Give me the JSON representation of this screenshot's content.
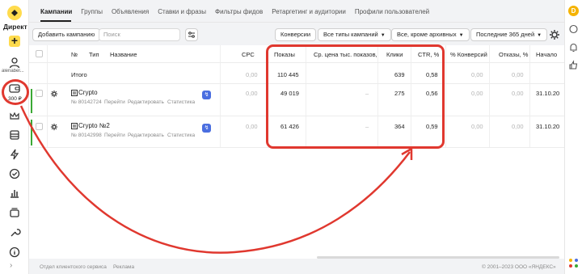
{
  "sidebar": {
    "brand": "Директ",
    "user": "alenabel...",
    "wallet": "300 ₽"
  },
  "tabs": [
    {
      "label": "Кампании",
      "active": true
    },
    {
      "label": "Группы"
    },
    {
      "label": "Объявления"
    },
    {
      "label": "Ставки и фразы"
    },
    {
      "label": "Фильтры фидов"
    },
    {
      "label": "Ретаргетинг и аудитории"
    },
    {
      "label": "Профили пользователей"
    }
  ],
  "toolbar": {
    "add_campaign": "Добавить кампанию",
    "search_placeholder": "Поиск",
    "conversions": "Конверсии",
    "campaign_types": "Все типы кампаний",
    "status_filter": "Все, кроме архивных",
    "period": "Последние 365 дней"
  },
  "table": {
    "headers": {
      "num": "№",
      "type": "Тип",
      "name": "Название",
      "cpc": "CPC",
      "impressions": "Показы",
      "cpm": "Ср. цена тыс. показов,",
      "clicks": "Клики",
      "ctr": "CTR, %",
      "conv": "% Конверсий",
      "bounces": "Отказы, %",
      "start": "Начало"
    },
    "total": {
      "label": "Итого",
      "cpc": "0,00",
      "impressions": "110 445",
      "clicks": "639",
      "ctr": "0,58",
      "conv": "0,00",
      "bounces": "0,00"
    },
    "rows": [
      {
        "name": "Crypto",
        "id": "№ 80142724",
        "actions": [
          "Перейти",
          "Редактировать",
          "Статистика"
        ],
        "cpc": "0,00",
        "impressions": "49 019",
        "cpm": "–",
        "clicks": "275",
        "ctr": "0,56",
        "conv": "0,00",
        "bounces": "0,00",
        "start": "31.10.20"
      },
      {
        "name": "Crypto №2",
        "id": "№ 80142998",
        "actions": [
          "Перейти",
          "Редактировать",
          "Статистика"
        ],
        "cpc": "0,00",
        "impressions": "61 426",
        "cpm": "–",
        "clicks": "364",
        "ctr": "0,59",
        "conv": "0,00",
        "bounces": "0,00",
        "start": "31.10.20"
      }
    ]
  },
  "footer": {
    "support": "Отдел клиентского сервиса",
    "ads": "Реклама",
    "copyright": "© 2001–2023 ООО «ЯНДЕКС»"
  },
  "colors": {
    "accent_yellow": "#ffdb4d",
    "annotation_red": "#e0382f",
    "active_green": "#3ba935",
    "badge_blue": "#4a6ee0"
  }
}
